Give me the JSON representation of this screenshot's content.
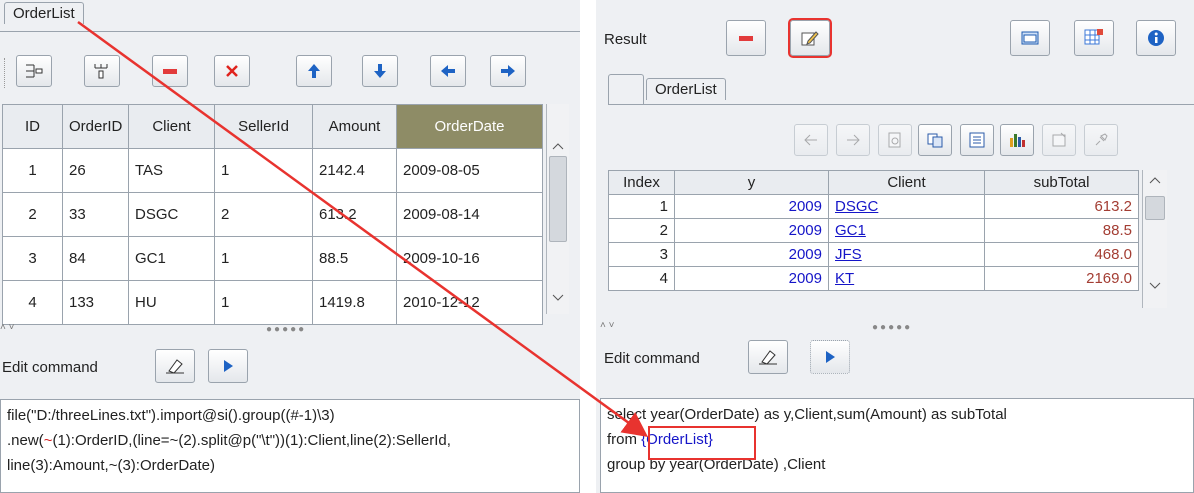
{
  "left": {
    "tab": "OrderList",
    "table": {
      "headers": [
        "ID",
        "OrderID",
        "Client",
        "SellerId",
        "Amount",
        "OrderDate"
      ],
      "selected_header": "OrderDate",
      "rows": [
        [
          "1",
          "26",
          "TAS",
          "1",
          "2142.4",
          "2009-08-05"
        ],
        [
          "2",
          "33",
          "DSGC",
          "2",
          "613.2",
          "2009-08-14"
        ],
        [
          "3",
          "84",
          "GC1",
          "1",
          "88.5",
          "2009-10-16"
        ],
        [
          "4",
          "133",
          "HU",
          "1",
          "1419.8",
          "2010-12-12"
        ]
      ]
    },
    "edit_label": "Edit command",
    "code": [
      "file(\"D:/threeLines.txt\").import@si().group((#-1)\\3)",
      ".new(",
      "~",
      "(1):OrderID,(line=~(2).split@p(\"\\t\"))(1):Client,line(2):SellerId,",
      "line(3):Amount,~(3):OrderDate)"
    ]
  },
  "right": {
    "result_label": "Result",
    "tab": "OrderList",
    "table": {
      "headers": [
        "Index",
        "y",
        "Client",
        "subTotal"
      ],
      "rows": [
        [
          "1",
          "2009",
          "DSGC",
          "613.2"
        ],
        [
          "2",
          "2009",
          "GC1",
          "88.5"
        ],
        [
          "3",
          "2009",
          "JFS",
          "468.0"
        ],
        [
          "4",
          "2009",
          "KT",
          "2169.0"
        ]
      ]
    },
    "edit_label": "Edit command",
    "code": [
      "select  year(OrderDate) as y,Client,sum(Amount) as subTotal",
      "from ",
      "{OrderList}",
      "group by year(OrderDate) ,Client"
    ]
  },
  "colors": {
    "highlight": "#e8332f",
    "selected_header": "#8e8c66",
    "number_blue": "#1515c8",
    "subtotal_red": "#a33d33"
  }
}
